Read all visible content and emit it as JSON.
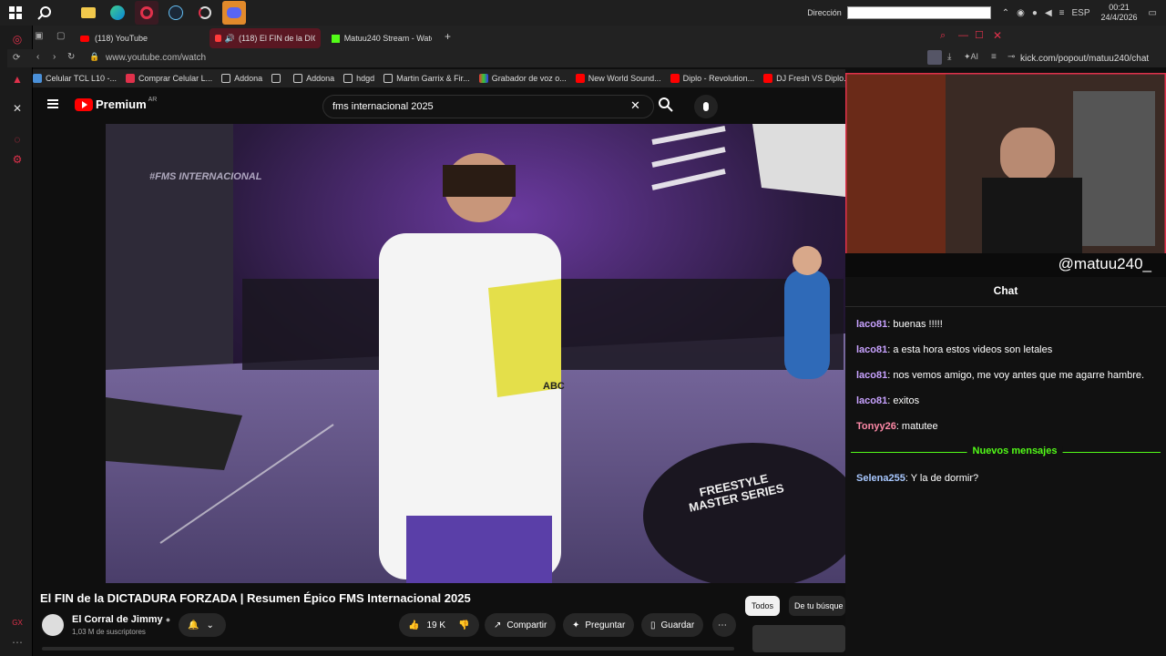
{
  "taskbar": {
    "dir_label": "Dirección",
    "lang": "ESP",
    "time": "00:21",
    "date": "24/4/2026"
  },
  "tabs": [
    {
      "label": "(118) YouTube",
      "icon": "youtube-icon"
    },
    {
      "label": "(118) El FIN de la DICTA",
      "icon": "speaker-icon"
    },
    {
      "label": "Matuu240 Stream - Watc",
      "icon": "kick-icon"
    }
  ],
  "address": {
    "url": "www.youtube.com/watch"
  },
  "bookmarks": [
    {
      "label": "Celular TCL L10 -..."
    },
    {
      "label": "Comprar Celular L..."
    },
    {
      "label": "Addona"
    },
    {
      "label": "Addona"
    },
    {
      "label": "hdgd"
    },
    {
      "label": "Martin Garrix & Fir..."
    },
    {
      "label": "Grabador de voz o..."
    },
    {
      "label": "New World Sound..."
    },
    {
      "label": "Diplo - Revolution..."
    },
    {
      "label": "DJ Fresh VS Diplo..."
    }
  ],
  "youtube": {
    "logo": "Premium",
    "region": "AR",
    "search_value": "fms internacional 2025",
    "video_title": "El FIN de la DICTADURA FORZADA | Resumen Épico FMS Internacional 2025",
    "channel_name": "El Corral de Jimmy",
    "subscribers": "1,03 M de suscriptores",
    "likes": "19 K",
    "share": "Compartir",
    "ask": "Preguntar",
    "save": "Guardar",
    "chip_all": "Todos",
    "chip_search": "De tu búsque",
    "video_overlay_text": "#FMS INTERNACIONAL",
    "banner_text": "FREESTYLE MASTER SERIES",
    "shirt_text": "ABC"
  },
  "kick": {
    "url": "kick.com/popout/matuu240/chat",
    "ai_label": "AI",
    "handle": "@matuu240_",
    "chat_title": "Chat",
    "messages": [
      {
        "user": "laco81",
        "text": ": buenas !!!!!",
        "color": "#c8a2ff"
      },
      {
        "user": "laco81",
        "text": ": a esta hora estos videos son letales",
        "color": "#c8a2ff"
      },
      {
        "user": "laco81",
        "text": ": nos vemos amigo, me voy antes que me agarre hambre.",
        "color": "#c8a2ff"
      },
      {
        "user": "laco81",
        "text": ": exitos",
        "color": "#c8a2ff"
      },
      {
        "user": "Tonyy26",
        "text": ": matutee",
        "color": "#ff8aa8"
      }
    ],
    "new_messages": "Nuevos mensajes",
    "after_messages": [
      {
        "user": "Selena255",
        "text": ": Y la de dormir?",
        "color": "#a8c8ff"
      }
    ]
  },
  "colors": {
    "accent_red": "#e0314b",
    "kick_green": "#53fc18"
  }
}
